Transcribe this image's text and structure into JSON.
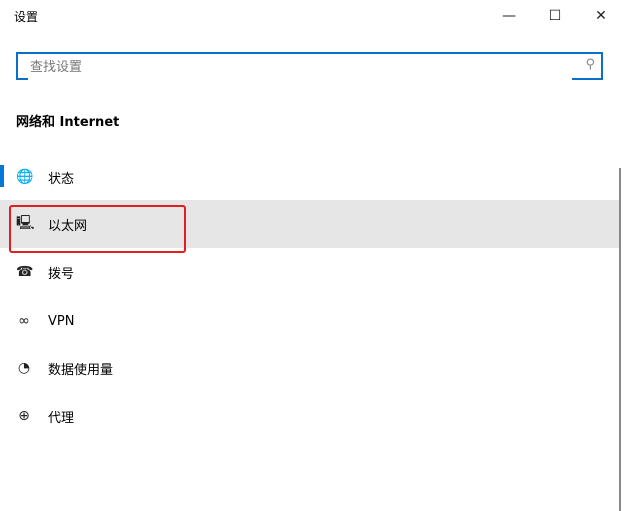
{
  "window": {
    "title": "设置",
    "minimize": "—",
    "maximize": "☐",
    "close": "✕"
  },
  "search": {
    "placeholder": "查找设置",
    "icon": "search-icon"
  },
  "section_title": "网络和 Internet",
  "nav": [
    {
      "label": "状态",
      "icon": "status-globe-icon",
      "glyph": "🌐"
    },
    {
      "label": "以太网",
      "icon": "ethernet-icon",
      "glyph": "🖳",
      "selected": true
    },
    {
      "label": "拨号",
      "icon": "dialup-icon",
      "glyph": "☎"
    },
    {
      "label": "VPN",
      "icon": "vpn-icon",
      "glyph": "∞"
    },
    {
      "label": "数据使用量",
      "icon": "data-usage-icon",
      "glyph": "◔"
    },
    {
      "label": "代理",
      "icon": "proxy-globe-icon",
      "glyph": "⊕"
    }
  ],
  "colors": {
    "accent": "#0078d7",
    "highlight": "#e02020"
  }
}
